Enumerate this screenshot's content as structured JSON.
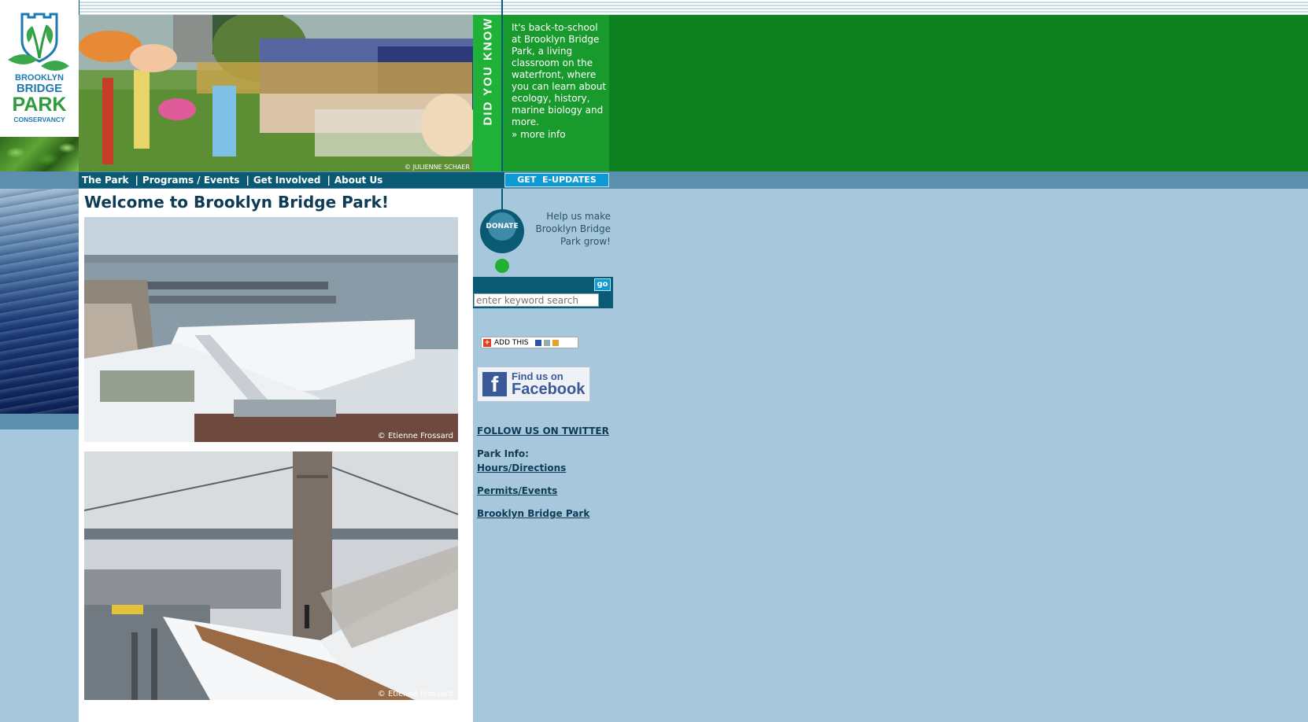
{
  "hero": {
    "credit": "© JULIENNE SCHAER"
  },
  "did_you_know": {
    "title": "DID YOU KNOW",
    "text": "It's back-to-school at Brooklyn Bridge Park, a living classroom on the waterfront, where you can learn about ecology, history, marine biology and more.",
    "more_link": "» more info"
  },
  "logo": {
    "alt": "Brooklyn Bridge Park Conservancy logo",
    "lines": [
      "BROOKLYN",
      "BRIDGE",
      "PARK",
      "CONSERVANCY"
    ]
  },
  "nav": {
    "items": [
      {
        "label": "The Park"
      },
      {
        "label": "Programs / Events"
      },
      {
        "label": "Get Involved"
      },
      {
        "label": "About Us"
      }
    ],
    "separator": "|",
    "eupdates_label": "GET  E-UPDATES"
  },
  "main": {
    "title": "Welcome to Brooklyn Bridge Park!",
    "photo1_credit": "© Etienne Frossard",
    "photo2_credit": "© Etienne Frossard"
  },
  "sidebar": {
    "donate_label": "DONATE",
    "donate_text": "Help us make Brooklyn Bridge Park grow!",
    "search": {
      "go_label": "go",
      "placeholder": "enter keyword search"
    },
    "addthis_label": "ADD THIS",
    "facebook": {
      "line1": "Find us on",
      "line2": "Facebook"
    },
    "twitter_link": "FOLLOW US ON TWITTER",
    "park_info_label": "Park Info:",
    "links": [
      "Hours/Directions",
      "Permits/Events",
      "Brooklyn Bridge Park"
    ]
  },
  "colors": {
    "background": "#a7c8dc",
    "dark_teal": "#0b5a74",
    "green": "#0d8020",
    "accent_blue": "#0e9ad4"
  }
}
